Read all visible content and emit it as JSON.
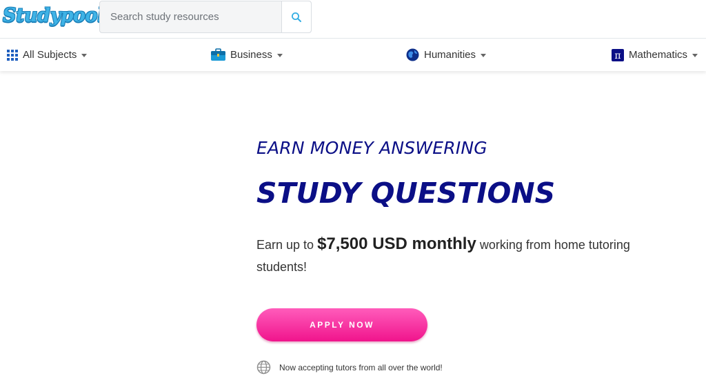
{
  "header": {
    "logo_text": "Studypool",
    "search_placeholder": "Search study resources",
    "search_icon": "magnifier-icon"
  },
  "subjects": [
    {
      "label": "All Subjects",
      "icon": "grid-icon"
    },
    {
      "label": "Business",
      "icon": "briefcase-icon"
    },
    {
      "label": "Humanities",
      "icon": "globe-icon"
    },
    {
      "label": "Mathematics",
      "icon": "pi-icon"
    }
  ],
  "hero": {
    "line1": "EARN MONEY ANSWERING",
    "line2": "STUDY QUESTIONS",
    "sub_prefix": "Earn up to ",
    "sub_highlight": "$7,500 USD monthly",
    "sub_suffix": " working from home tutoring students!",
    "button_label": "APPLY NOW",
    "note": "Now accepting tutors from all over the world!"
  },
  "colors": {
    "brand_blue": "#3fb3e6",
    "heading_navy": "#0b0f86",
    "cta_pink": "#f0148c"
  }
}
